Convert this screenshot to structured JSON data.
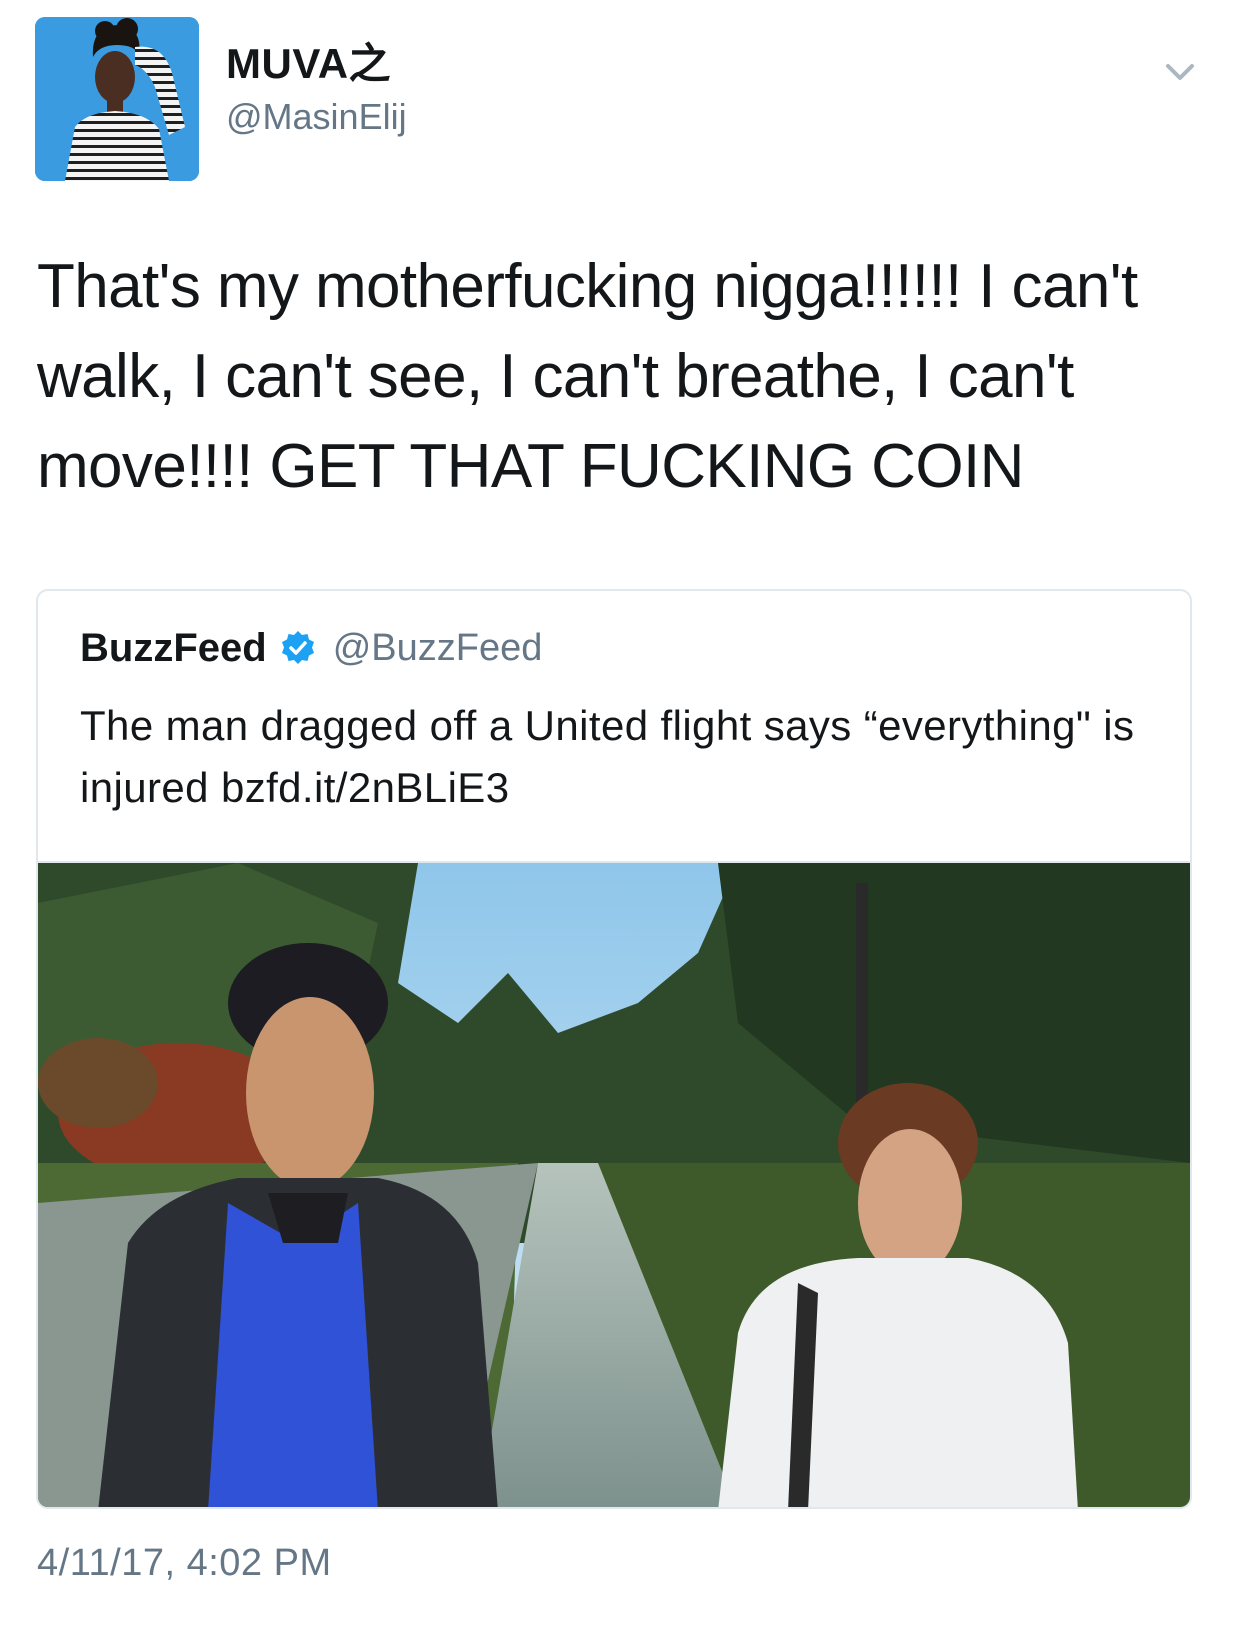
{
  "tweet": {
    "author": {
      "display_name": "MUVA之",
      "handle": "@MasinElij"
    },
    "caret_icon": "chevron-down-icon",
    "text": "That's my motherfucking nigga!!!!!! I can't walk, I can't see, I can't breathe, I can't move!!!! GET THAT FUCKING COIN",
    "timestamp": "4/11/17, 4:02 PM"
  },
  "quoted_tweet": {
    "display_name": "BuzzFeed",
    "verified_icon": "verified-badge-icon",
    "handle": "@BuzzFeed",
    "text": "The man dragged off a United flight says “everything\" is injured bzfd.it/2nBLiE3"
  },
  "colors": {
    "text_primary": "#14171a",
    "text_secondary": "#657786",
    "border": "#e1e8ed",
    "verified_blue": "#1da1f2"
  }
}
